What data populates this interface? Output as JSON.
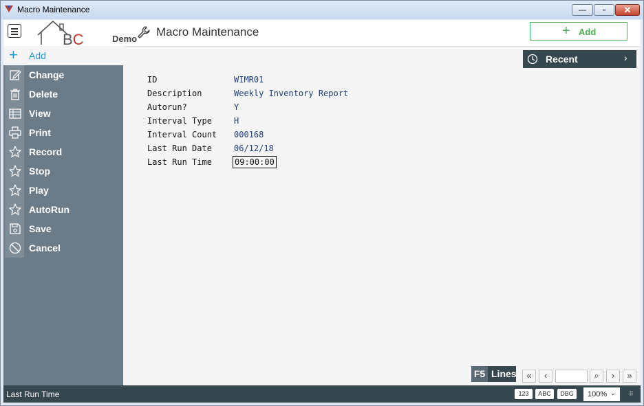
{
  "window": {
    "title": "Macro Maintenance",
    "min": "—",
    "max": "▫",
    "close": "✕"
  },
  "header": {
    "logo_prefix": "B",
    "logo_accent": "C",
    "logo_demo": "Demo",
    "page_title": "Macro Maintenance",
    "add_label": "Add"
  },
  "sidebar": {
    "add_label": "Add",
    "items": [
      {
        "label": "Change",
        "icon": "edit-icon"
      },
      {
        "label": "Delete",
        "icon": "trash-icon"
      },
      {
        "label": "View",
        "icon": "table-icon"
      },
      {
        "label": "Print",
        "icon": "printer-icon"
      },
      {
        "label": "Record",
        "icon": "star-icon"
      },
      {
        "label": "Stop",
        "icon": "star-icon"
      },
      {
        "label": "Play",
        "icon": "star-icon"
      },
      {
        "label": "AutoRun",
        "icon": "star-icon"
      },
      {
        "label": "Save",
        "icon": "save-icon"
      },
      {
        "label": "Cancel",
        "icon": "cancel-icon"
      }
    ]
  },
  "recent": {
    "label": "Recent"
  },
  "form": {
    "id": {
      "label": "ID",
      "value": "WIMR01"
    },
    "description": {
      "label": "Description",
      "value": "Weekly Inventory Report"
    },
    "autorun": {
      "label": "Autorun?",
      "value": "Y"
    },
    "interval_type": {
      "label": "Interval Type",
      "value": "H"
    },
    "interval_count": {
      "label": "Interval Count",
      "value": "000168"
    },
    "last_run_date": {
      "label": "Last Run Date",
      "value": "06/12/18"
    },
    "last_run_time": {
      "label": "Last Run Time",
      "value": "09:00:00"
    }
  },
  "lines_button": {
    "key": "F5",
    "label": "Lines"
  },
  "pager": {
    "first": "«",
    "prev": "‹",
    "next": "›",
    "last": "»",
    "search": "⌕",
    "page_value": ""
  },
  "status": {
    "text": "Last Run Time",
    "badge_123": "123",
    "badge_abc": "ABC",
    "badge_dbg": "DBG",
    "zoom": "100%",
    "zoom_chevron": "⌄"
  },
  "colors": {
    "accent_blue": "#1e9bd7",
    "accent_green": "#4caf50",
    "sidebar": "#6b7b87",
    "status_bar": "#37474f"
  }
}
